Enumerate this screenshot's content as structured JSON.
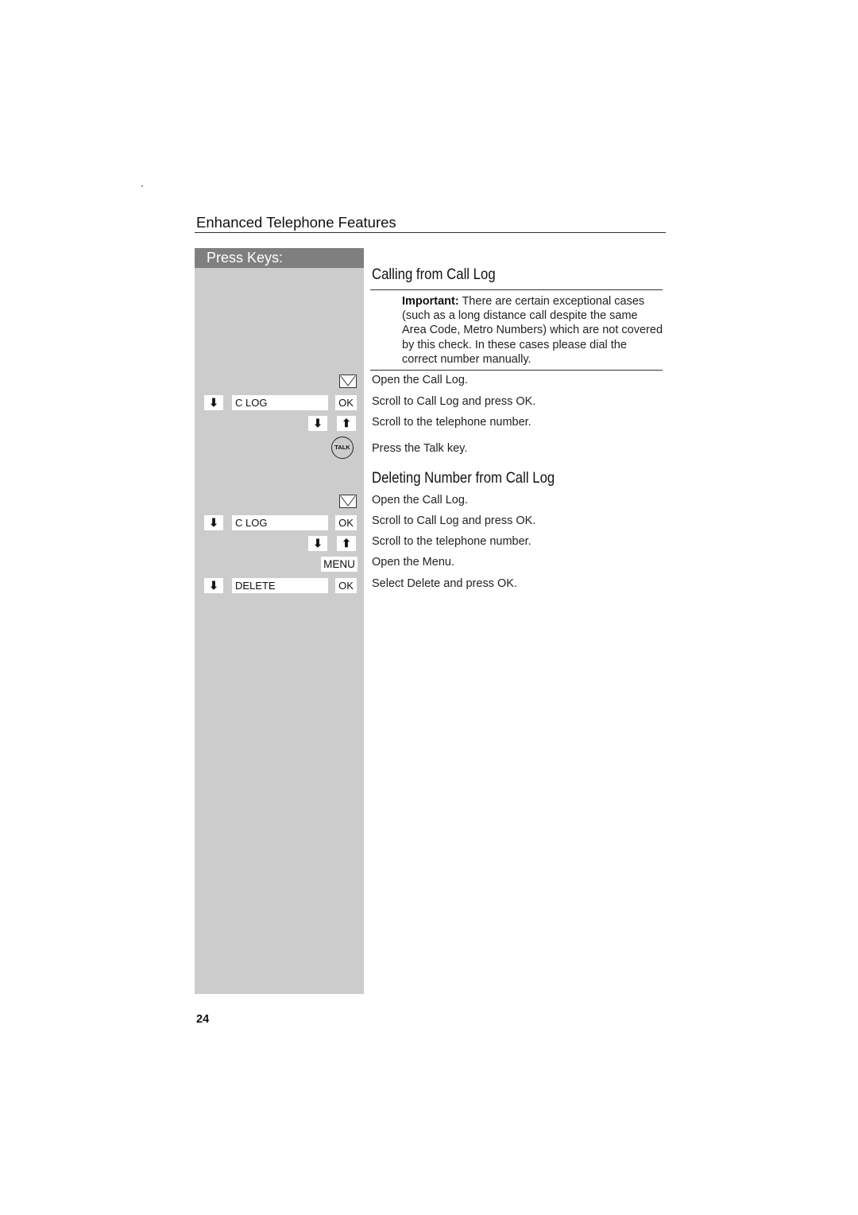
{
  "header": {
    "section_title": "Enhanced Telephone Features"
  },
  "keys_panel": {
    "title": "Press Keys:"
  },
  "calling": {
    "title": "Calling from Call Log",
    "note_label": "Important:",
    "note_text": " There are certain exceptional cases (such as a long distance call despite the same Area Code, Metro Numbers) which are not covered by this check. In these cases please dial the correct number manually.",
    "steps": [
      {
        "text": "Open the Call Log.",
        "keys": {
          "icon": "envelope-icon"
        }
      },
      {
        "text": "Scroll to Call Log and press OK.",
        "keys": {
          "arrow": "⬇",
          "label": "C LOG",
          "confirm": "OK"
        }
      },
      {
        "text": "Scroll to the telephone number.",
        "keys": {
          "down": "⬇",
          "up": "⬆"
        }
      },
      {
        "text": "Press the Talk key.",
        "keys": {
          "talk": "TALK"
        }
      }
    ]
  },
  "deleting": {
    "title": "Deleting Number from Call Log",
    "steps": [
      {
        "text": "Open the Call Log.",
        "keys": {
          "icon": "envelope-icon"
        }
      },
      {
        "text": "Scroll to Call Log and press OK.",
        "keys": {
          "arrow": "⬇",
          "label": "C LOG",
          "confirm": "OK"
        }
      },
      {
        "text": "Scroll to the telephone number.",
        "keys": {
          "down": "⬇",
          "up": "⬆"
        }
      },
      {
        "text": "Open the Menu.",
        "keys": {
          "menu": "MENU"
        }
      },
      {
        "text": "Select Delete and press OK.",
        "keys": {
          "arrow": "⬇",
          "label": "DELETE",
          "confirm": "OK"
        }
      }
    ]
  },
  "footer": {
    "page_number": "24"
  }
}
